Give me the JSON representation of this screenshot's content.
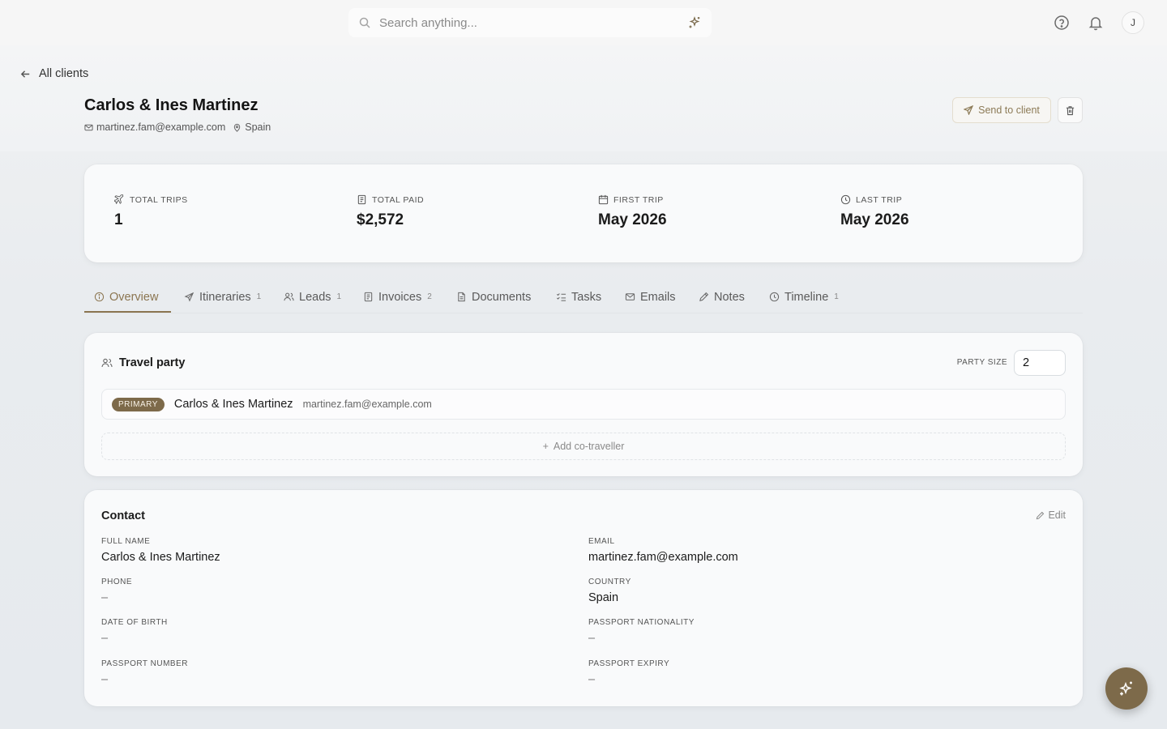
{
  "search": {
    "placeholder": "Search anything..."
  },
  "user": {
    "avatar_initial": "J"
  },
  "nav": {
    "back_label": "All clients"
  },
  "client": {
    "name": "Carlos & Ines Martinez",
    "email": "martinez.fam@example.com",
    "location": "Spain"
  },
  "actions": {
    "send_label": "Send to client"
  },
  "stats": [
    {
      "label": "TOTAL TRIPS",
      "value": "1",
      "icon": "plane-icon"
    },
    {
      "label": "TOTAL PAID",
      "value": "$2,572",
      "icon": "receipt-icon"
    },
    {
      "label": "FIRST TRIP",
      "value": "May 2026",
      "icon": "calendar-icon"
    },
    {
      "label": "LAST TRIP",
      "value": "May 2026",
      "icon": "clock-icon"
    }
  ],
  "tabs": [
    {
      "label": "Overview",
      "count": ""
    },
    {
      "label": "Itineraries",
      "count": "1"
    },
    {
      "label": "Leads",
      "count": "1"
    },
    {
      "label": "Invoices",
      "count": "2"
    },
    {
      "label": "Documents",
      "count": ""
    },
    {
      "label": "Tasks",
      "count": ""
    },
    {
      "label": "Emails",
      "count": ""
    },
    {
      "label": "Notes",
      "count": ""
    },
    {
      "label": "Timeline",
      "count": "1"
    }
  ],
  "party": {
    "title": "Travel party",
    "size_label": "PARTY SIZE",
    "size_value": "2",
    "primary_badge": "PRIMARY",
    "primary_name": "Carlos & Ines Martinez",
    "primary_email": "martinez.fam@example.com",
    "add_label": "Add co-traveller"
  },
  "contact": {
    "title": "Contact",
    "edit_label": "Edit",
    "fields": [
      {
        "label": "FULL NAME",
        "value": "Carlos & Ines Martinez"
      },
      {
        "label": "EMAIL",
        "value": "martinez.fam@example.com"
      },
      {
        "label": "PHONE",
        "value": "–"
      },
      {
        "label": "COUNTRY",
        "value": "Spain"
      },
      {
        "label": "DATE OF BIRTH",
        "value": "–"
      },
      {
        "label": "PASSPORT NATIONALITY",
        "value": "–"
      },
      {
        "label": "PASSPORT NUMBER",
        "value": "–"
      },
      {
        "label": "PASSPORT EXPIRY",
        "value": "–"
      }
    ]
  },
  "colors": {
    "accent": "#8b7550",
    "badge": "#7d6a4a"
  }
}
